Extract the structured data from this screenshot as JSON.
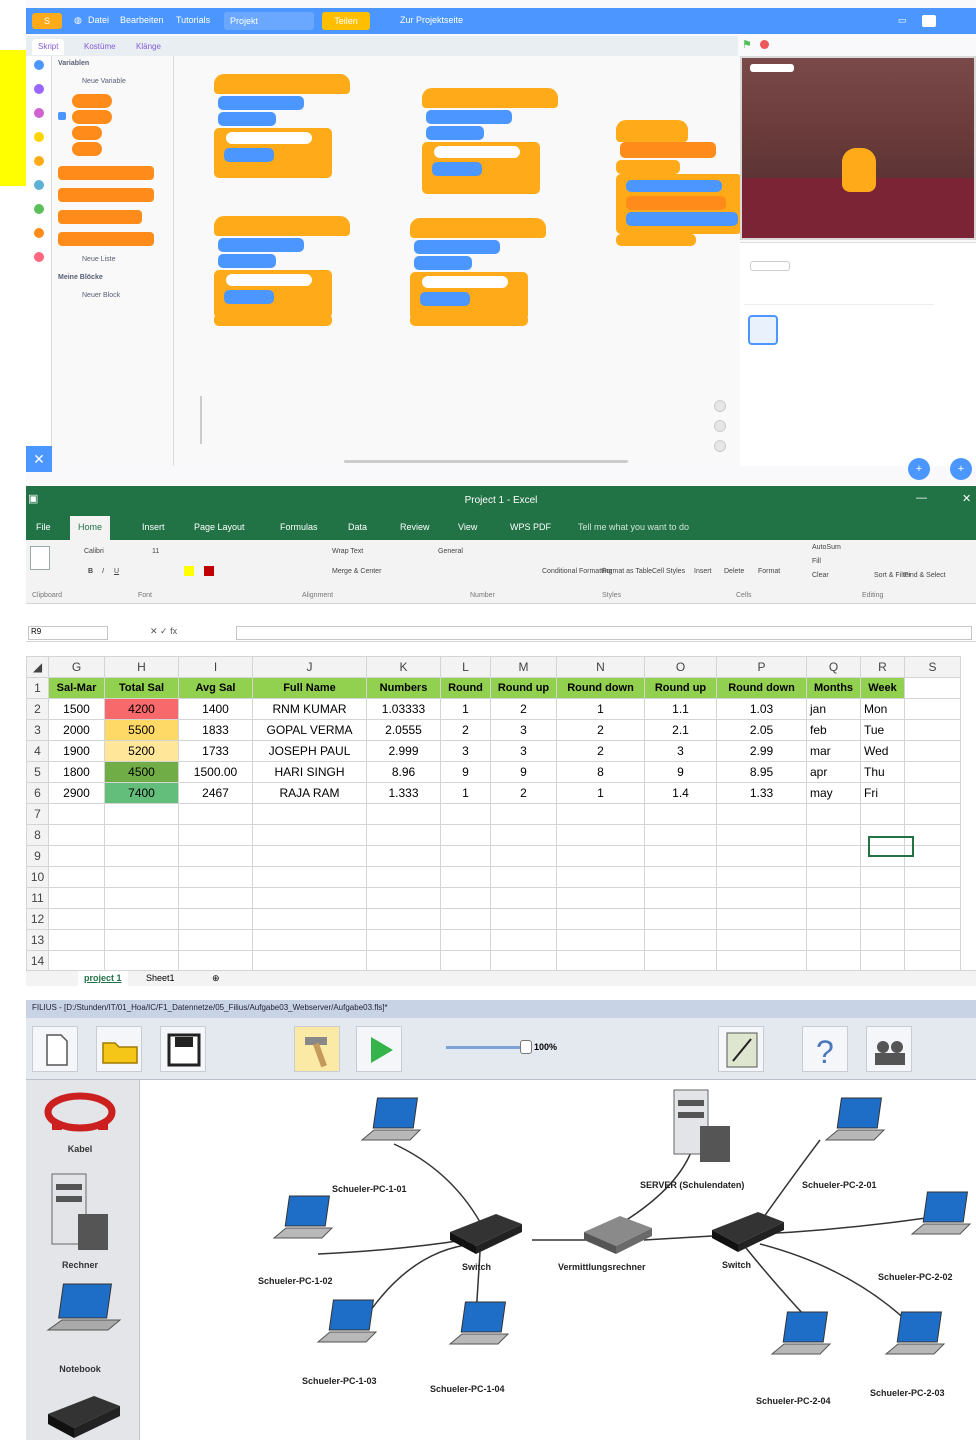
{
  "scratch": {
    "menu": [
      "Datei",
      "Bearbeiten",
      "Tutorials",
      "Projekt",
      "Teilen",
      "Zur Projektseite"
    ],
    "tabs": [
      "Skript",
      "Kostüme",
      "Klänge"
    ],
    "palette_title": "Variablen",
    "palette_texts": [
      "Neue Variable",
      "Neue Liste",
      "Meine Blöcke",
      "Neuer Block"
    ]
  },
  "excel": {
    "title": "Project 1 - Excel",
    "menu": [
      "File",
      "Home",
      "Insert",
      "Page Layout",
      "Formulas",
      "Data",
      "Review",
      "View",
      "WPS PDF",
      "Tell me what you want to do"
    ],
    "ribbon": {
      "font_name": "Calibri",
      "font_size": "11",
      "wrap_text": "Wrap Text",
      "merge_center": "Merge & Center",
      "number_format": "General",
      "conditional_formatting": "Conditional Formatting",
      "format_as_table": "Format as Table",
      "cell_styles": "Cell Styles",
      "insert": "Insert",
      "delete": "Delete",
      "format": "Format",
      "autosum": "AutoSum",
      "fill": "Fill",
      "clear": "Clear",
      "sort_filter": "Sort & Filter",
      "find_select": "Find & Select",
      "groups": [
        "Clipboard",
        "Font",
        "Alignment",
        "Number",
        "Styles",
        "Cells",
        "Editing"
      ]
    },
    "namebox": "R9",
    "columns": [
      "G",
      "H",
      "I",
      "J",
      "K",
      "L",
      "M",
      "N",
      "O",
      "P",
      "Q",
      "R",
      "S"
    ],
    "header_row": [
      "Sal-Mar",
      "Total Sal",
      "Avg Sal",
      "Full Name",
      "Numbers",
      "Round",
      "Round up",
      "Round down",
      "Round up",
      "Round down",
      "Months",
      "Week"
    ],
    "rows": [
      [
        "1500",
        "4200",
        "1400",
        "RNM KUMAR",
        "1.03333",
        "1",
        "2",
        "1",
        "1.1",
        "1.03",
        "jan",
        "Mon"
      ],
      [
        "2000",
        "5500",
        "1833",
        "GOPAL VERMA",
        "2.0555",
        "2",
        "3",
        "2",
        "2.1",
        "2.05",
        "feb",
        "Tue"
      ],
      [
        "1900",
        "5200",
        "1733",
        "JOSEPH PAUL",
        "2.999",
        "3",
        "3",
        "2",
        "3",
        "2.99",
        "mar",
        "Wed"
      ],
      [
        "1800",
        "4500",
        "1500.00",
        "HARI SINGH",
        "8.96",
        "9",
        "9",
        "8",
        "9",
        "8.95",
        "apr",
        "Thu"
      ],
      [
        "2900",
        "7400",
        "2467",
        "RAJA RAM",
        "1.333",
        "1",
        "2",
        "1",
        "1.4",
        "1.33",
        "may",
        "Fri"
      ]
    ],
    "total_sal_colors": [
      "#f8696b",
      "#ffd966",
      "#ffe699",
      "#70ad47",
      "#63be7b"
    ],
    "row_numbers": [
      "1",
      "2",
      "3",
      "4",
      "5",
      "6",
      "7",
      "8",
      "9",
      "10",
      "11",
      "12",
      "13",
      "14"
    ],
    "sheet_tabs": [
      "project 1",
      "Sheet1"
    ]
  },
  "filius": {
    "title": "FILIUS - [D:/Stunden/IT/01_Hoa/IC/F1_Datennetze/05_Filius/Aufgabe03_Webserver/Aufgabe03.fls]*",
    "zoom": "100%",
    "sidebar": [
      "Kabel",
      "Rechner",
      "Notebook"
    ],
    "nodes": {
      "pc101": "Schueler-PC-1-01",
      "pc102": "Schueler-PC-1-02",
      "pc103": "Schueler-PC-1-03",
      "pc104": "Schueler-PC-1-04",
      "switch1": "Switch",
      "router": "Vermittlungsrechner",
      "server": "SERVER (Schulendaten)",
      "switch2": "Switch",
      "pc201": "Schueler-PC-2-01",
      "pc202": "Schueler-PC-2-02",
      "pc203": "Schueler-PC-2-03",
      "pc204": "Schueler-PC-2-04"
    }
  }
}
